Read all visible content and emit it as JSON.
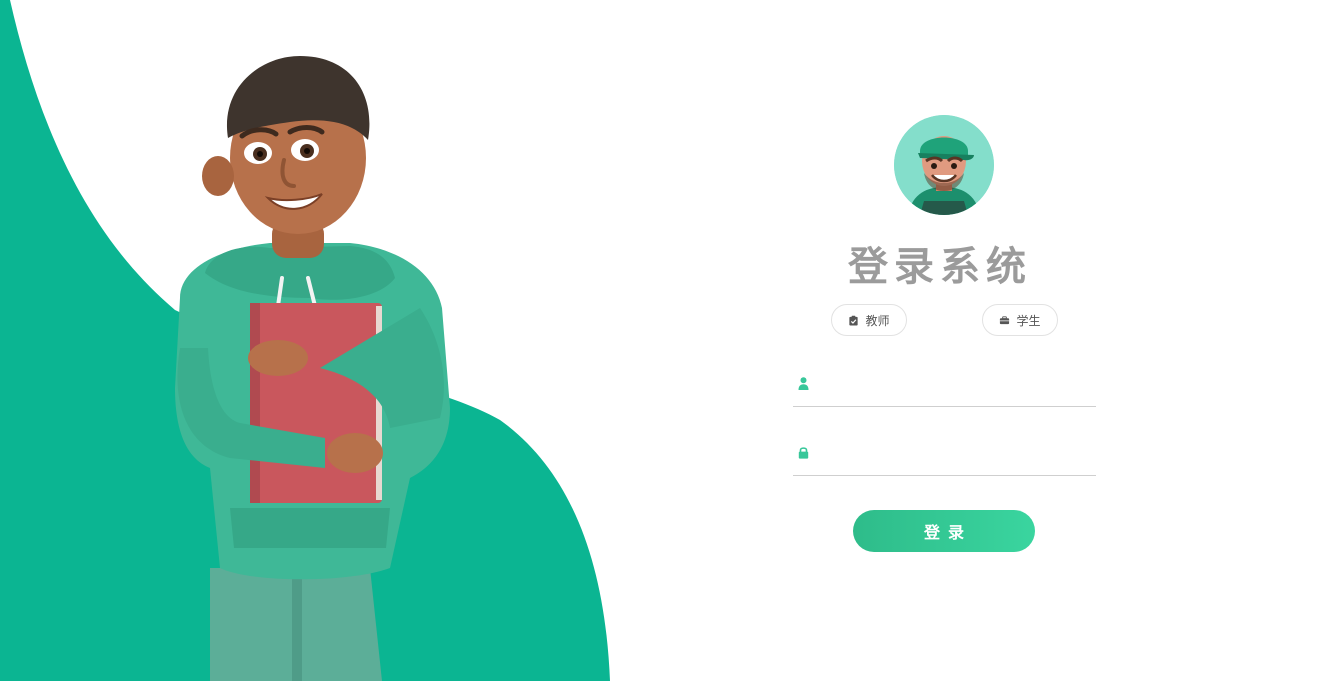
{
  "colors": {
    "accent": "#0bb592",
    "button_gradient_start": "#2ebc8a",
    "button_gradient_end": "#3ad59f",
    "title": "#9b9b9b",
    "field_icon": "#38c79a"
  },
  "hero": {
    "illustration": "student-holding-book-illustration"
  },
  "login": {
    "avatar": "avatar-icon",
    "title": "登录系统",
    "roles": [
      {
        "label": "教师",
        "icon": "clipboard-icon"
      },
      {
        "label": "学生",
        "icon": "briefcase-icon"
      }
    ],
    "username": {
      "value": "",
      "icon": "user-icon"
    },
    "password": {
      "value": "",
      "icon": "lock-icon"
    },
    "submit_label": "登录"
  }
}
